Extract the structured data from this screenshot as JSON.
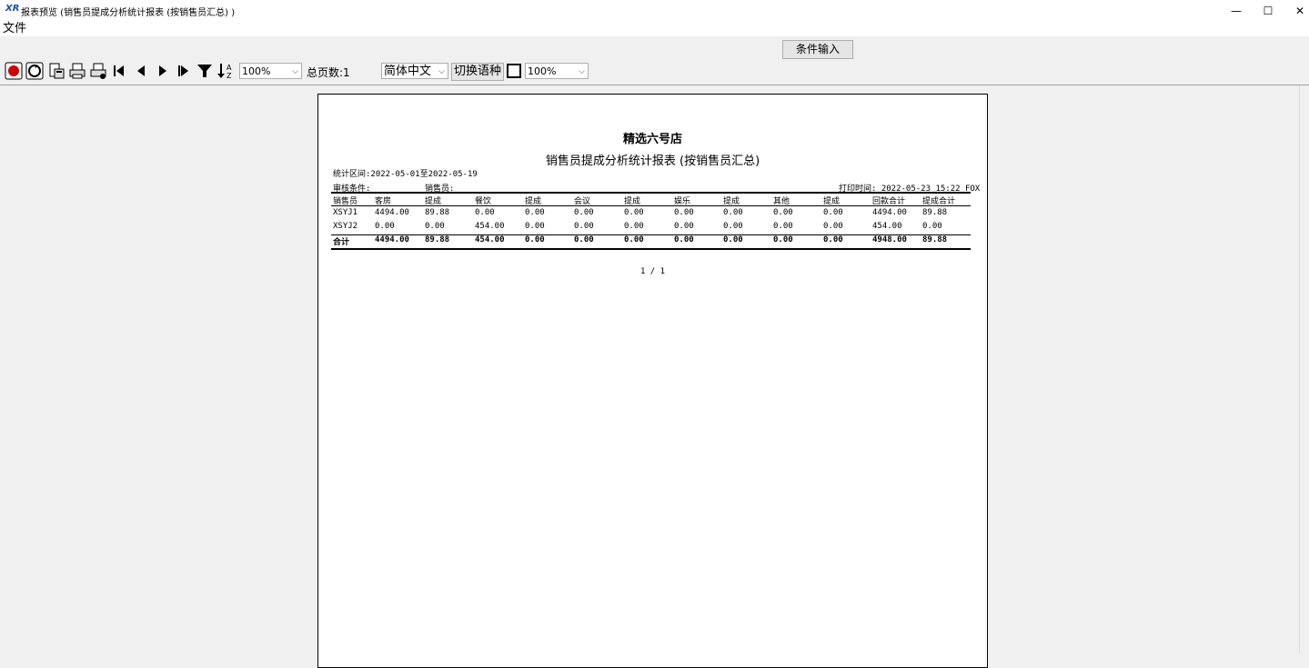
{
  "window": {
    "title": "报表预览 (销售员提成分析统计报表 (按销售员汇总) )",
    "logo": "XR",
    "minimize": "—",
    "maximize": "☐",
    "close": "✕"
  },
  "menu": {
    "file": "文件"
  },
  "toolbar": {
    "condition_button": "条件输入",
    "zoom1": "100%",
    "total_pages": "总页数:1",
    "language": "简体中文",
    "switch_language": "切换语种",
    "zoom2": "100%"
  },
  "report": {
    "store": "精选六号店",
    "title": "销售员提成分析统计报表 (按销售员汇总)",
    "period": "统计区间:2022-05-01至2022-05-19",
    "audit": "审核条件:",
    "salesperson": "销售员:",
    "print_time": "打印时间: 2022-05-23 15:22 FOX",
    "headers": [
      "销售员",
      "客房",
      "提成",
      "餐饮",
      "提成",
      "会议",
      "提成",
      "娱乐",
      "提成",
      "其他",
      "提成",
      "回款合计",
      "提成合计"
    ],
    "rows": [
      [
        "XSYJ1",
        "4494.00",
        "89.88",
        "0.00",
        "0.00",
        "0.00",
        "0.00",
        "0.00",
        "0.00",
        "0.00",
        "0.00",
        "4494.00",
        "89.88"
      ],
      [
        "XSYJ2",
        "0.00",
        "0.00",
        "454.00",
        "0.00",
        "0.00",
        "0.00",
        "0.00",
        "0.00",
        "0.00",
        "0.00",
        "454.00",
        "0.00"
      ]
    ],
    "total": [
      "合计",
      "4494.00",
      "89.88",
      "454.00",
      "0.00",
      "0.00",
      "0.00",
      "0.00",
      "0.00",
      "0.00",
      "0.00",
      "4948.00",
      "89.88"
    ],
    "pager": "1 / 1"
  },
  "icons": [
    "stop-icon",
    "refresh-icon",
    "export-icon",
    "print-icon",
    "print-setup-icon",
    "first-page-icon",
    "prev-page-icon",
    "next-page-icon",
    "last-page-icon",
    "filter-icon",
    "sort-icon"
  ]
}
